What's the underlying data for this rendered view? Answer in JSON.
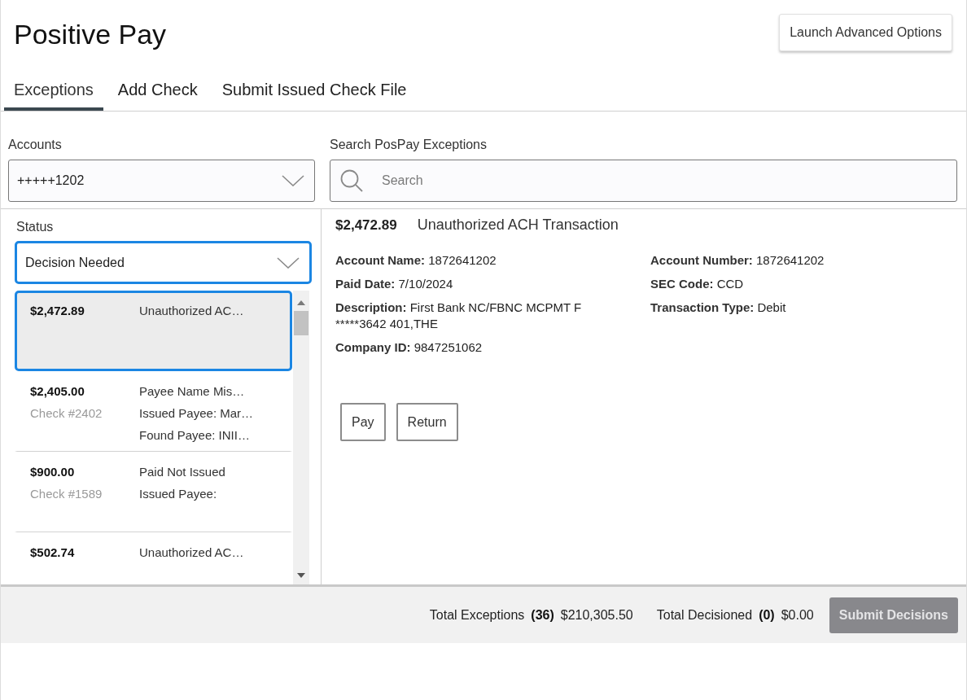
{
  "title": "Positive Pay",
  "advanced_options_button": "Launch Advanced Options",
  "tabs": [
    {
      "label": "Exceptions",
      "selected": true
    },
    {
      "label": "Add Check",
      "selected": false
    },
    {
      "label": "Submit Issued Check File",
      "selected": false
    }
  ],
  "accounts": {
    "label": "Accounts",
    "value": "+++++1202"
  },
  "search": {
    "label": "Search PosPay Exceptions",
    "placeholder": "Search"
  },
  "status": {
    "label": "Status",
    "value": "Decision Needed",
    "focused": true
  },
  "exceptions": [
    {
      "amount": "$2,472.89",
      "lines": [
        "Unauthorized AC…"
      ],
      "selected": true
    },
    {
      "amount": "$2,405.00",
      "check": "Check #2402",
      "lines": [
        "Payee Name Mis…",
        "Issued Payee: Mar…",
        "Found Payee: INII…"
      ],
      "selected": false
    },
    {
      "amount": "$900.00",
      "check": "Check #1589",
      "lines": [
        "Paid Not Issued",
        "Issued Payee:"
      ],
      "selected": false
    },
    {
      "amount": "$502.74",
      "lines": [
        "Unauthorized AC…"
      ],
      "selected": false
    }
  ],
  "detail": {
    "amount": "$2,472.89",
    "type": "Unauthorized ACH Transaction",
    "fields_left": [
      {
        "label": "Account Name:",
        "value": "1872641202"
      },
      {
        "label": "Paid Date:",
        "value": "7/10/2024"
      },
      {
        "label": "Description:",
        "value": "First Bank NC/FBNC MCPMT F *****3642 401,THE"
      },
      {
        "label": "Company ID:",
        "value": "9847251062"
      }
    ],
    "fields_right": [
      {
        "label": "Account Number:",
        "value": "1872641202"
      },
      {
        "label": "SEC Code:",
        "value": "CCD"
      },
      {
        "label": "Transaction Type:",
        "value": "Debit"
      }
    ],
    "actions": [
      "Pay",
      "Return"
    ]
  },
  "totals": [
    {
      "label": "Total Exceptions",
      "count": "(36)",
      "amount": "$210,305.50"
    },
    {
      "label": "Total Decisioned",
      "count": "(0)",
      "amount": "$0.00"
    }
  ],
  "submit_button": {
    "label": "Submit Decisions",
    "disabled": true
  }
}
